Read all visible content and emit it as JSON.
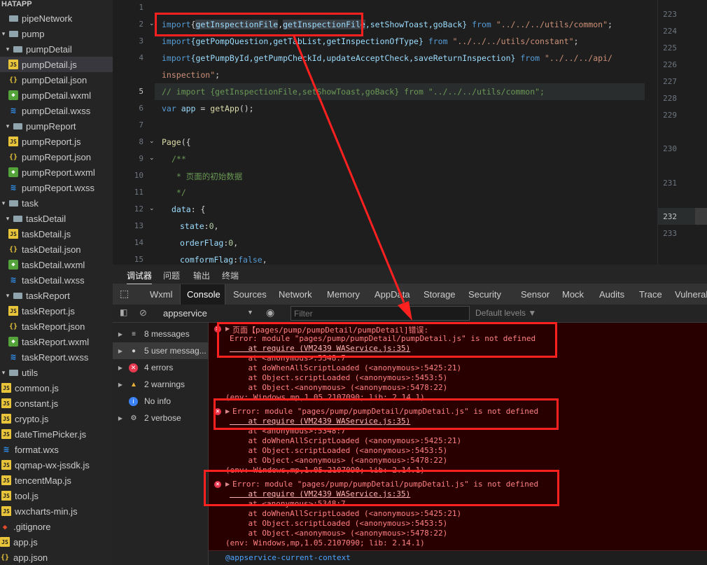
{
  "explorer": {
    "title": "HATAPP",
    "items": [
      {
        "label": "pipeNetwork",
        "type": "folder",
        "depth": 0,
        "chev": ""
      },
      {
        "label": "pump",
        "type": "folder",
        "depth": 0,
        "chev": "▾"
      },
      {
        "label": "pumpDetail",
        "type": "folder",
        "depth": 1,
        "chev": "▾"
      },
      {
        "label": "pumpDetail.js",
        "type": "js",
        "depth": 2,
        "chev": ""
      },
      {
        "label": "pumpDetail.json",
        "type": "json",
        "depth": 2,
        "chev": ""
      },
      {
        "label": "pumpDetail.wxml",
        "type": "wxml",
        "depth": 2,
        "chev": ""
      },
      {
        "label": "pumpDetail.wxss",
        "type": "wxss",
        "depth": 2,
        "chev": ""
      },
      {
        "label": "pumpReport",
        "type": "folder",
        "depth": 1,
        "chev": "▾"
      },
      {
        "label": "pumpReport.js",
        "type": "js",
        "depth": 2,
        "chev": ""
      },
      {
        "label": "pumpReport.json",
        "type": "json",
        "depth": 2,
        "chev": ""
      },
      {
        "label": "pumpReport.wxml",
        "type": "wxml",
        "depth": 2,
        "chev": ""
      },
      {
        "label": "pumpReport.wxss",
        "type": "wxss",
        "depth": 2,
        "chev": ""
      },
      {
        "label": "task",
        "type": "folder",
        "depth": 0,
        "chev": "▾"
      },
      {
        "label": "taskDetail",
        "type": "folder",
        "depth": 1,
        "chev": "▾"
      },
      {
        "label": "taskDetail.js",
        "type": "js",
        "depth": 2,
        "chev": ""
      },
      {
        "label": "taskDetail.json",
        "type": "json",
        "depth": 2,
        "chev": ""
      },
      {
        "label": "taskDetail.wxml",
        "type": "wxml",
        "depth": 2,
        "chev": ""
      },
      {
        "label": "taskDetail.wxss",
        "type": "wxss",
        "depth": 2,
        "chev": ""
      },
      {
        "label": "taskReport",
        "type": "folder",
        "depth": 1,
        "chev": "▾"
      },
      {
        "label": "taskReport.js",
        "type": "js",
        "depth": 2,
        "chev": ""
      },
      {
        "label": "taskReport.json",
        "type": "json",
        "depth": 2,
        "chev": ""
      },
      {
        "label": "taskReport.wxml",
        "type": "wxml",
        "depth": 2,
        "chev": ""
      },
      {
        "label": "taskReport.wxss",
        "type": "wxss",
        "depth": 2,
        "chev": ""
      },
      {
        "label": "utils",
        "type": "folder",
        "depth": -1,
        "chev": "▾"
      },
      {
        "label": "common.js",
        "type": "js",
        "depth": 0,
        "chev": ""
      },
      {
        "label": "constant.js",
        "type": "js",
        "depth": 0,
        "chev": ""
      },
      {
        "label": "crypto.js",
        "type": "js",
        "depth": 0,
        "chev": ""
      },
      {
        "label": "dateTimePicker.js",
        "type": "js",
        "depth": 0,
        "chev": ""
      },
      {
        "label": "format.wxs",
        "type": "wxss",
        "depth": 0,
        "chev": ""
      },
      {
        "label": "qqmap-wx-jssdk.js",
        "type": "js",
        "depth": 0,
        "chev": ""
      },
      {
        "label": "tencentMap.js",
        "type": "js",
        "depth": 0,
        "chev": ""
      },
      {
        "label": "tool.js",
        "type": "js",
        "depth": 0,
        "chev": ""
      },
      {
        "label": "wxcharts-min.js",
        "type": "js",
        "depth": 0,
        "chev": ""
      },
      {
        "label": ".gitignore",
        "type": "git",
        "depth": -1,
        "chev": ""
      },
      {
        "label": "app.js",
        "type": "js",
        "depth": -1,
        "chev": ""
      },
      {
        "label": "app.json",
        "type": "json",
        "depth": -1,
        "chev": ""
      }
    ]
  },
  "editor": {
    "line_numbers": [
      "1",
      "2",
      "3",
      "4",
      "",
      "5",
      "6",
      "7",
      "8",
      "9",
      "10",
      "11",
      "12",
      "13",
      "14",
      "15"
    ],
    "right_line_numbers": [
      "223",
      "224",
      "225",
      "226",
      "227",
      "228",
      "229",
      "230",
      "231",
      "232",
      "233"
    ],
    "code": {
      "l2_kw": "import",
      "l2_b1": "{",
      "l2_f1": "getInspectionFile",
      "l2_c1": ",",
      "l2_f2": "getInspectionFile",
      "l2_rest": ",setShowToast,goBack}",
      "l2_from": " from ",
      "l2_str": "\"../../../utils/common\"",
      "l2_end": ";",
      "l3_kw": "import",
      "l3_vars": "{getPompQuestion,getTabList,getInspectionOfType}",
      "l3_from": " from ",
      "l3_str": "\"../../../utils/constant\"",
      "l3_end": ";",
      "l4_kw": "import",
      "l4_vars": "{getPumpById,getPumpCheckId,updateAcceptCheck,saveReturnInspection}",
      "l4_from": " from ",
      "l4_str": "\"../../../api/",
      "l4b_str": "inspection\"",
      "l4b_end": ";",
      "l5_comment": "// import {getInspectionFile,setShowToast,goBack} from \"../../../utils/common\";",
      "l6_kw": "var",
      "l6_var": " app ",
      "l6_eq": "= ",
      "l6_fn": "getApp",
      "l6_end": "();",
      "l8_fn": "Page",
      "l8_end": "({",
      "l9": "/**",
      "l10": " * 页面的初始数据",
      "l11": " */",
      "l12_key": "data",
      "l12_end": ": {",
      "l13_key": "state",
      "l13_val": "0",
      "l14_key": "orderFlag",
      "l14_val": "0",
      "l15_key": "comformFlag",
      "l15_val": "false"
    }
  },
  "devtools": {
    "top_tabs": [
      "调试器",
      "问题",
      "输出",
      "终端"
    ],
    "panel_tabs": [
      "Wxml",
      "Console",
      "Sources",
      "Network",
      "Memory",
      "AppData",
      "Storage",
      "Security",
      "Sensor",
      "Mock",
      "Audits",
      "Trace",
      "Vulnerab"
    ],
    "context_select": "appservice",
    "filter_placeholder": "Filter",
    "levels_label": "Default levels ▼",
    "sidebar": [
      {
        "label": "8 messages",
        "icon": "list-icon"
      },
      {
        "label": "5 user messag...",
        "icon": "user-icon"
      },
      {
        "label": "4 errors",
        "icon": "error-icon"
      },
      {
        "label": "2 warnings",
        "icon": "warning-icon"
      },
      {
        "label": "No info",
        "icon": "info-icon"
      },
      {
        "label": "2 verbose",
        "icon": "verbose-icon"
      }
    ],
    "block1": [
      "页面【pages/pump/pumpDetail/pumpDetail]错误:",
      "Error: module \"pages/pump/pumpDetail/pumpDetail.js\" is not defined",
      "    at require (VM2439 WAService.js:35)",
      "    at <anonymous>:5348:7",
      "    at doWhenAllScriptLoaded (<anonymous>:5425:21)",
      "    at Object.scriptLoaded (<anonymous>:5453:5)",
      "    at Object.<anonymous> (<anonymous>:5478:22)",
      "(env: Windows,mp,1.05.2107090; lib: 2.14.1)"
    ],
    "block2": [
      "Error: module \"pages/pump/pumpDetail/pumpDetail.js\" is not defined",
      "    at require (VM2439 WAService.js:35)",
      "    at <anonymous>:5348:7",
      "    at doWhenAllScriptLoaded (<anonymous>:5425:21)",
      "    at Object.scriptLoaded (<anonymous>:5453:5)",
      "    at Object.<anonymous> (<anonymous>:5478:22)",
      "(env: Windows,mp,1.05.2107090; lib: 2.14.1)"
    ],
    "block3": [
      "Error: module \"pages/pump/pumpDetail/pumpDetail.js\" is not defined",
      "    at require (VM2439 WAService.js:35)",
      "    at <anonymous>:5348:7",
      "    at doWhenAllScriptLoaded (<anonymous>:5425:21)",
      "    at Object.scriptLoaded (<anonymous>:5453:5)",
      "    at Object.<anonymous> (<anonymous>:5478:22)",
      "(env: Windows,mp,1.05.2107090; lib: 2.14.1)"
    ],
    "context_label": "@appservice-current-context"
  },
  "colors": {
    "annotation_red": "#ff2020",
    "error_bg": "#290000",
    "error_text": "#ff8080"
  }
}
